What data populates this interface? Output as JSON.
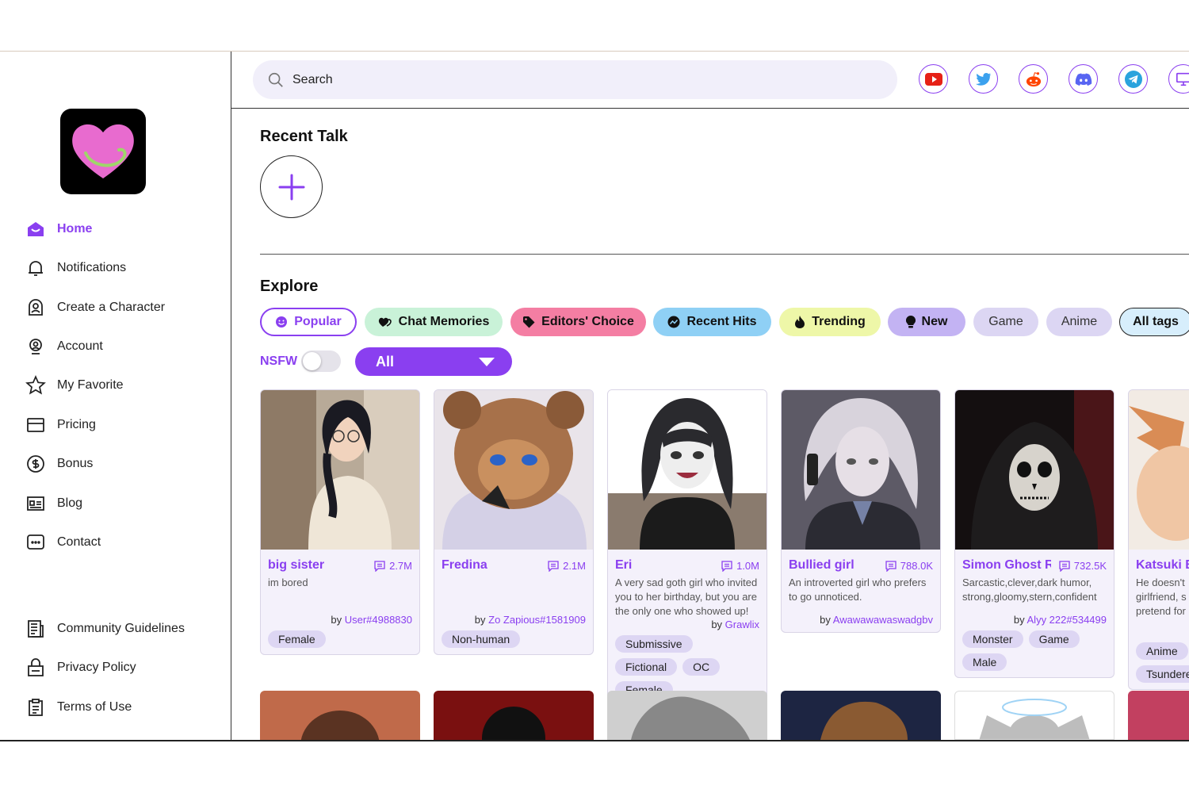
{
  "colors": {
    "accent": "#8a3ff0",
    "sidebar_border": "#333333"
  },
  "sidebar": {
    "logo_icon": "heart-logo-icon",
    "nav": [
      {
        "label": "Home",
        "icon": "home-icon",
        "active": true
      },
      {
        "label": "Notifications",
        "icon": "bell-icon"
      },
      {
        "label": "Create a Character",
        "icon": "character-icon"
      },
      {
        "label": "Account",
        "icon": "account-icon"
      },
      {
        "label": "My Favorite",
        "icon": "star-icon"
      },
      {
        "label": "Pricing",
        "icon": "card-icon"
      },
      {
        "label": "Bonus",
        "icon": "dollar-icon"
      },
      {
        "label": "Blog",
        "icon": "blog-icon"
      },
      {
        "label": "Contact",
        "icon": "chat-icon"
      }
    ],
    "footer": [
      {
        "label": "Community Guidelines",
        "icon": "guidelines-icon"
      },
      {
        "label": "Privacy Policy",
        "icon": "lock-icon"
      },
      {
        "label": "Terms of Use",
        "icon": "clipboard-icon"
      }
    ]
  },
  "header": {
    "search_placeholder": "Search",
    "social": [
      "youtube-icon",
      "twitter-icon",
      "reddit-icon",
      "discord-icon",
      "telegram-icon",
      "desktop-icon"
    ]
  },
  "recent": {
    "title": "Recent Talk"
  },
  "explore": {
    "title": "Explore",
    "tags": [
      {
        "label": "Popular",
        "bg": "#ffffff",
        "border": "#8a3ff0",
        "color": "#8a3ff0",
        "icon": "smile-icon"
      },
      {
        "label": "Chat Memories",
        "bg": "#c9f2d8",
        "icon": "hearts-icon"
      },
      {
        "label": "Editors' Choice",
        "bg": "#f47ea3",
        "icon": "tag-icon"
      },
      {
        "label": "Recent Hits",
        "bg": "#8fd0f5",
        "icon": "chart-icon"
      },
      {
        "label": "Trending",
        "bg": "#eef7a8",
        "icon": "fire-icon"
      },
      {
        "label": "New",
        "bg": "#c3b3f3",
        "icon": "bulb-icon"
      },
      {
        "label": "Game",
        "bg": "#dcd6f3"
      },
      {
        "label": "Anime",
        "bg": "#dcd6f3"
      },
      {
        "label": "All tags",
        "bg": "#d7eefc",
        "border": "#222222"
      }
    ],
    "nsfw_label": "NSFW",
    "nsfw_on": false,
    "filter_value": "All"
  },
  "cards": [
    {
      "name": "big sister",
      "count": "2.7M",
      "desc": "im bored",
      "by_prefix": "by ",
      "author": "User#4988830",
      "tags": [
        "Female"
      ]
    },
    {
      "name": "Fredina",
      "count": "2.1M",
      "desc": "",
      "by_prefix": "by ",
      "author": "Zo Zapious#1581909",
      "tags": [
        "Non-human"
      ]
    },
    {
      "name": "Eri",
      "count": "1.0M",
      "desc": "A very sad goth girl who invited you to her birthday, but you are the only one who showed up!",
      "by_prefix": "by ",
      "author": "Grawlix",
      "tags": [
        "Submissive",
        "Fictional",
        "OC",
        "Female"
      ]
    },
    {
      "name": "Bullied girl",
      "count": "788.0K",
      "desc": "An introverted girl who prefers to go unnoticed.",
      "by_prefix": "by ",
      "author": "Awawawawaswadgbv",
      "tags": []
    },
    {
      "name": "Simon Ghost Ril...",
      "count": "732.5K",
      "desc": "Sarcastic,clever,dark humor, strong,gloomy,stern,confident",
      "by_prefix": "by ",
      "author": "Alyy 222#534499",
      "tags": [
        "Monster",
        "Game",
        "Male"
      ]
    },
    {
      "name": "Katsuki B",
      "count": "",
      "desc": "He doesn't girlfriend, s pretend for",
      "by_prefix": "",
      "author": "",
      "tags": [
        "Anime",
        "Tsundere"
      ]
    }
  ]
}
